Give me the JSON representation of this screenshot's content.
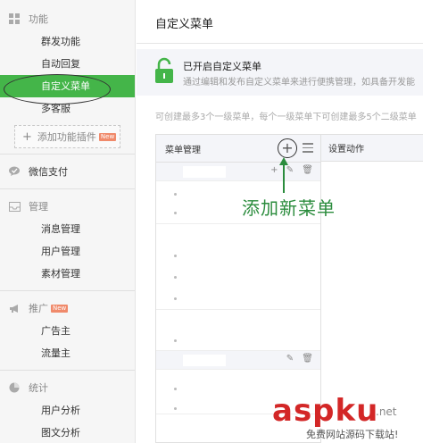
{
  "sidebar": {
    "groups": [
      {
        "title": "功能",
        "icon": "grid-icon",
        "items": [
          {
            "label": "群发功能",
            "active": false
          },
          {
            "label": "自动回复",
            "active": false
          },
          {
            "label": "自定义菜单",
            "active": true
          },
          {
            "label": "多客服",
            "active": false
          }
        ]
      },
      {
        "title": "微信支付",
        "icon": "wechat-pay-icon",
        "items": []
      },
      {
        "title": "管理",
        "icon": "inbox-icon",
        "items": [
          {
            "label": "消息管理"
          },
          {
            "label": "用户管理"
          },
          {
            "label": "素材管理"
          }
        ]
      },
      {
        "title": "推广",
        "icon": "megaphone-icon",
        "badge": "New",
        "items": [
          {
            "label": "广告主"
          },
          {
            "label": "流量主"
          }
        ]
      },
      {
        "title": "统计",
        "icon": "pie-icon",
        "items": [
          {
            "label": "用户分析"
          },
          {
            "label": "图文分析"
          }
        ]
      }
    ],
    "add_plugin": {
      "label": "添加功能插件",
      "badge": "New"
    }
  },
  "main": {
    "page_title": "自定义菜单",
    "notice": {
      "title": "已开启自定义菜单",
      "desc": "通过编辑和发布自定义菜单来进行便携管理，如具备开发能"
    },
    "hint": "可创建最多3个一级菜单，每个一级菜单下可创建最多5个二级菜单",
    "panel": {
      "header": "菜单管理",
      "add_symbol": "+",
      "row_tools_1": [
        "+",
        "✎",
        "🗑"
      ],
      "row_tools_2": [
        "✎",
        "🗑"
      ]
    },
    "settings_header": "设置动作"
  },
  "annotation": {
    "text": "添加新菜单",
    "color": "#2b8c3d"
  },
  "watermark": {
    "brand": "aspku",
    "suffix": ".net",
    "tagline": "免费网站源码下载站!"
  },
  "colors": {
    "accent": "#44b549",
    "sidebar_bg": "#f6f6f6",
    "panel_head_bg": "#f4f5f9"
  }
}
